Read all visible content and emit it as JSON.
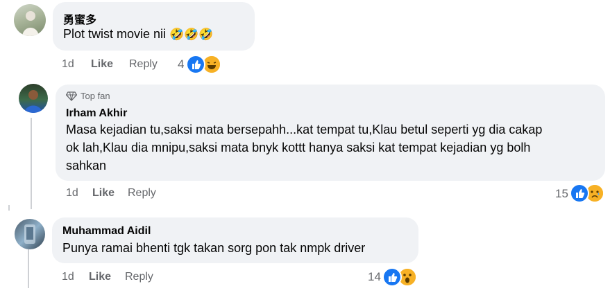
{
  "comments": [
    {
      "author": "勇蜜多",
      "text": "Plot twist movie nii",
      "time": "1d",
      "like_label": "Like",
      "reply_label": "Reply",
      "reaction_count": "4",
      "reactions": [
        "like-icon",
        "laughing-icon"
      ]
    },
    {
      "badge": "Top fan",
      "author": "Irham Akhir",
      "text_lines": [
        "Masa kejadian tu,saksi mata bersepahh...kat tempat tu,Klau betul seperti yg dia cakap",
        "ok lah,Klau dia mnipu,saksi mata bnyk kottt hanya saksi kat tempat kejadian yg bolh",
        "sahkan"
      ],
      "time": "1d",
      "like_label": "Like",
      "reply_label": "Reply",
      "reaction_count": "15",
      "reactions": [
        "like-icon",
        "sad-icon"
      ]
    },
    {
      "author": "Muhammad Aidil",
      "text": "Punya ramai bhenti tgk takan sorg pon tak nmpk driver",
      "time": "1d",
      "like_label": "Like",
      "reply_label": "Reply",
      "reaction_count": "14",
      "reactions": [
        "like-icon",
        "wow-icon"
      ]
    }
  ],
  "colors": {
    "bubble": "#f0f2f5",
    "like_blue": "#1877f2",
    "emoji_yellow": "#f7b125",
    "meta_gray": "#65676b"
  }
}
